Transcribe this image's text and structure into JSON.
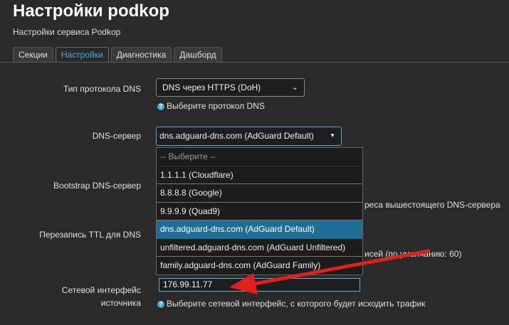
{
  "header": {
    "title": "Настройки podkop",
    "subtitle": "Настройки сервиса Podkop"
  },
  "tabs": [
    {
      "label": "Секции",
      "active": false
    },
    {
      "label": "Настройки",
      "active": true
    },
    {
      "label": "Диагностика",
      "active": false
    },
    {
      "label": "Дашборд",
      "active": false
    }
  ],
  "form": {
    "dns_protocol": {
      "label": "Тип протокола DNS",
      "value": "DNS через HTTPS (DoH)",
      "help": "Выберите протокол DNS"
    },
    "dns_server": {
      "label": "DNS-сервер",
      "value": "dns.adguard-dns.com (AdGuard Default)",
      "options": [
        "-- Выберите --",
        "1.1.1.1 (Cloudflare)",
        "8.8.8.8 (Google)",
        "9.9.9.9 (Quad9)",
        "dns.adguard-dns.com (AdGuard Default)",
        "unfiltered.adguard-dns.com (AdGuard Unfiltered)",
        "family.adguard-dns.com (AdGuard Family)"
      ],
      "custom_input": "176.99.11.77"
    },
    "bootstrap_dns": {
      "label": "Bootstrap DNS-сервер",
      "help_partial": "реса вышестоящего DNS-сервера"
    },
    "ttl_rewrite": {
      "label": "Перезапись TTL для DNS",
      "help_partial": "исей (по умолчанию: 60)"
    },
    "source_interface": {
      "label": "Сетевой интерфейс источника",
      "help": "Выберите сетевой интерфейс, с которого будет исходить трафик"
    }
  },
  "colors": {
    "background": "#2a2a2a",
    "accent": "#4fa8e0",
    "selected_option": "#1d6f98",
    "annotation_arrow": "#e0201c"
  },
  "icons": {
    "help": "question-circle-icon",
    "select_caret": "caret-down-icon"
  }
}
